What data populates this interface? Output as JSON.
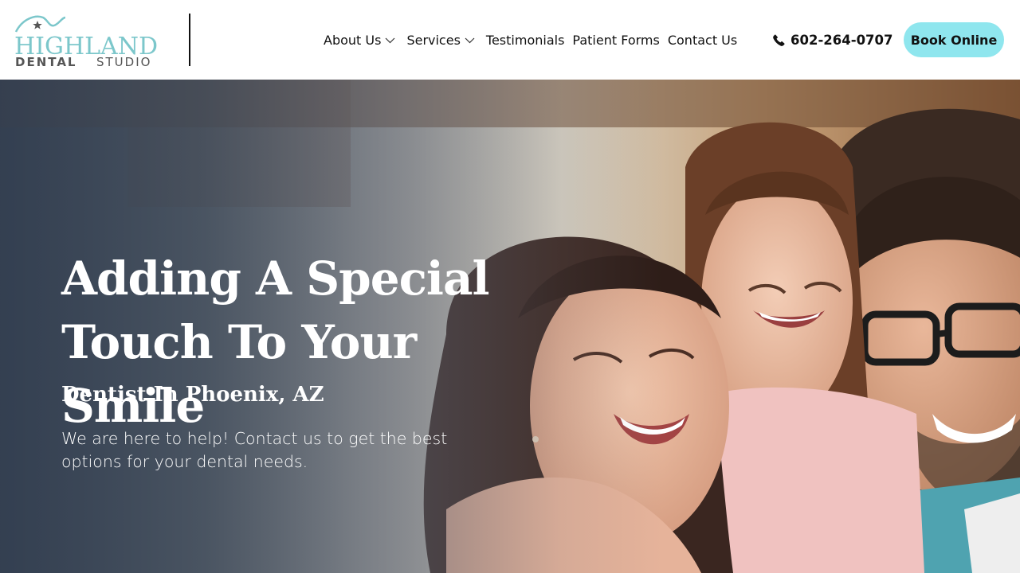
{
  "brand": {
    "logo_top": "HIGHLAND",
    "logo_bottom_bold": "DENTAL",
    "logo_bottom_light": "STUDIO",
    "teal": "#7cc7cb",
    "gray": "#555555"
  },
  "nav": {
    "items": [
      {
        "label": "About Us",
        "has_dropdown": true
      },
      {
        "label": "Services",
        "has_dropdown": true
      },
      {
        "label": "Testimonials",
        "has_dropdown": false
      },
      {
        "label": "Patient Forms",
        "has_dropdown": false
      },
      {
        "label": "Contact Us",
        "has_dropdown": false
      }
    ]
  },
  "header": {
    "phone": "602-264-0707",
    "phone_icon": "phone-icon",
    "book_label": "Book Online",
    "book_color": "#8fe6ee"
  },
  "hero": {
    "title": "Adding A Special Touch To Your Smile",
    "subtitle": "Dentist In Phoenix, AZ",
    "text": "We are here to help! Contact us to get the best options for your dental needs."
  }
}
